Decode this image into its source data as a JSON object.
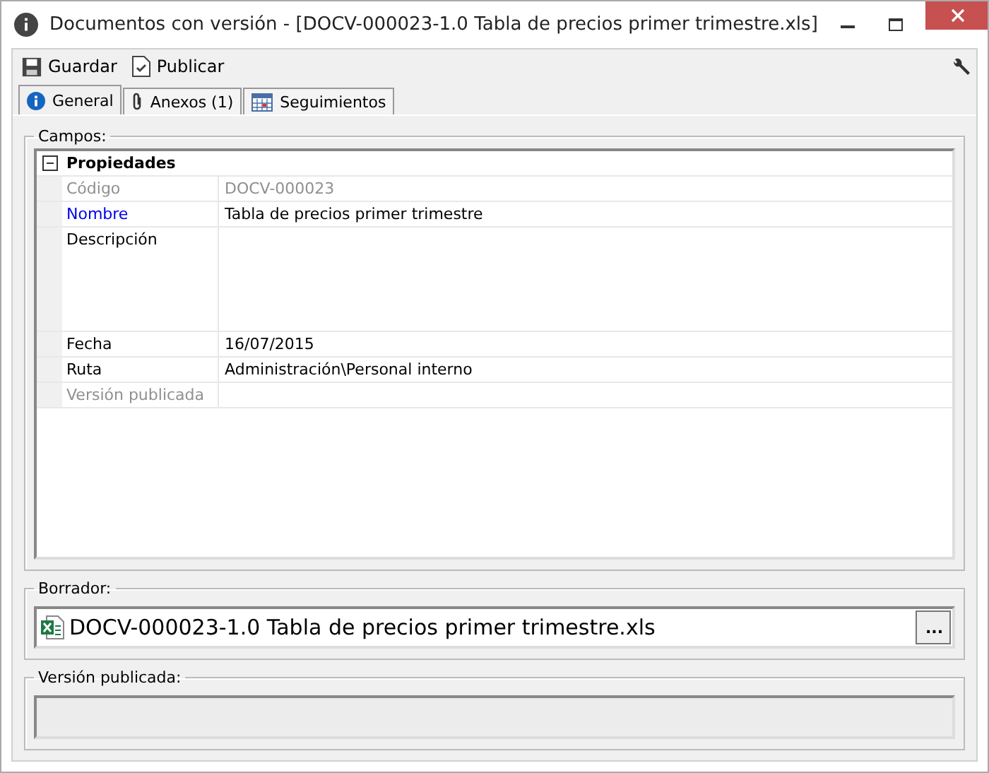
{
  "window": {
    "title": "Documentos con versión - [DOCV-000023-1.0 Tabla de precios primer trimestre.xls]"
  },
  "toolbar": {
    "buttons": [
      {
        "label": "Guardar",
        "kind": "save"
      },
      {
        "label": "Publicar",
        "kind": "publish"
      }
    ]
  },
  "tabs": [
    {
      "label": "General",
      "kind": "info",
      "selected": true
    },
    {
      "label": "Anexos (1)",
      "kind": "clip",
      "selected": false
    },
    {
      "label": "Seguimientos",
      "kind": "calendar",
      "selected": false
    }
  ],
  "fields": {
    "title": "Campos:",
    "group": {
      "label": "Propiedades",
      "expanded": true,
      "rows": [
        {
          "name": "Código",
          "value": "DOCV-000023",
          "kind": "readonly",
          "multiline": false
        },
        {
          "name": "Nombre",
          "value": "Tabla de precios primer trimestre",
          "kind": "required",
          "multiline": false
        },
        {
          "name": "Descripción",
          "kind": "normal",
          "multiline": true
        },
        {
          "name": "Fecha",
          "value": "16/07/2015",
          "kind": "normal",
          "multiline": false
        },
        {
          "name": "Ruta",
          "value": "Administración\\Personal interno",
          "kind": "normal",
          "multiline": false
        },
        {
          "name": "Versión publicada",
          "kind": "readonly",
          "multiline": false
        }
      ]
    }
  },
  "draft": {
    "title": "Borrador:",
    "file": "DOCV-000023-1.0 Tabla de precios primer trimestre.xls",
    "button": "..."
  },
  "published": {
    "title": "Versión publicada:"
  }
}
